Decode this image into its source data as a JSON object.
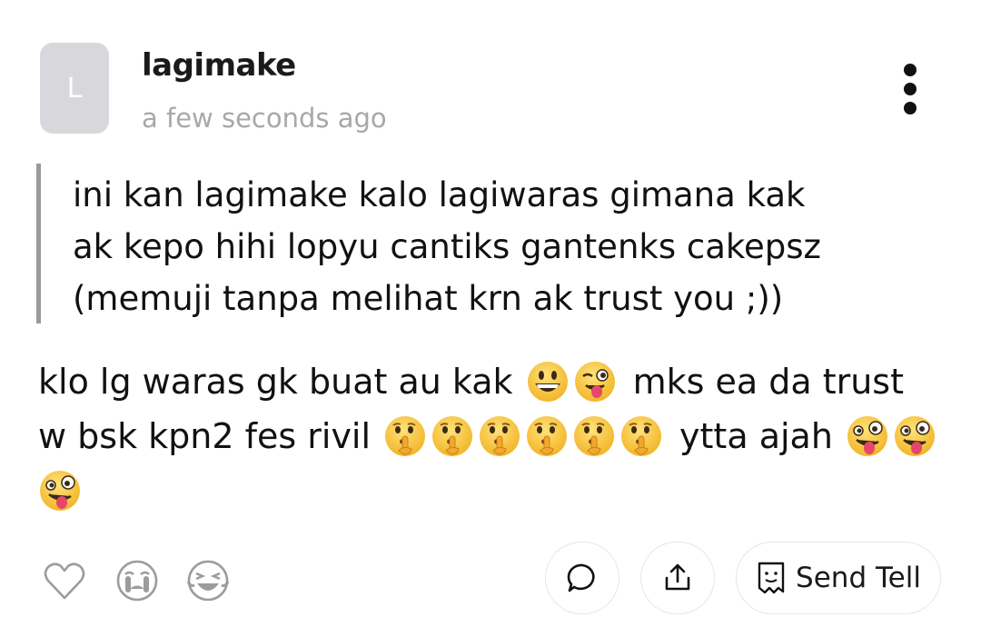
{
  "post": {
    "avatar_initial": "L",
    "username": "lagimake",
    "timestamp": "a few seconds ago",
    "quote_lines": [
      "ini kan lagimake kalo lagiwaras gimana kak",
      "ak kepo hihi lopyu cantiks gantenks cakepsz",
      "(memuji tanpa melihat krn ak trust you ;))"
    ],
    "message": {
      "line1_a": "klo lg waras gk buat au kak",
      "line1_b": "mks ea da trust",
      "line2_a": "w bsk kpn2 fes rivil",
      "line2_b": "ytta ajah"
    }
  },
  "icons": {
    "more": "more-vertical-icon",
    "like": "heart-outline-icon",
    "cry": "crying-face-icon",
    "laugh": "laughing-face-icon",
    "comment": "comment-bubble-icon",
    "share": "share-upload-icon",
    "tell": "tell-note-icon"
  },
  "actions": {
    "send_tell_label": "Send Tell"
  },
  "colors": {
    "avatar_bg": "#d8d8dc",
    "muted": "#a8a8a8",
    "quote_bar": "#9a9a9a",
    "emoji": "#f5c33b"
  }
}
